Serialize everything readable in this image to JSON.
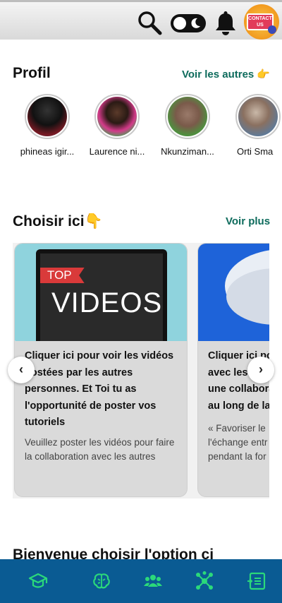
{
  "header": {
    "contact_badge": "CONTACT US",
    "icons": [
      "search-icon",
      "dark-mode-toggle",
      "bell-icon",
      "contact-us-button"
    ]
  },
  "profiles_section": {
    "title": "Profil",
    "see_all": "Voir les autres 👉",
    "profiles": [
      {
        "name": "phineas igir..."
      },
      {
        "name": "Laurence ni..."
      },
      {
        "name": "Nkunziman..."
      },
      {
        "name": "Orti Sma"
      }
    ]
  },
  "choose_section": {
    "title": "Choisir ici👇",
    "see_more": "Voir plus",
    "cards": [
      {
        "badge": "TOP",
        "media_text": "VIDEOS",
        "title": "Cliquer ici pour voir les vidéos postées par les autres personnes. Et Toi tu as l'opportunité de poster vos tutoriels",
        "description": "Veuillez poster les vidéos pour faire la collaboration avec les autres"
      },
      {
        "title": "Cliquer ici po avec les aut une collabora au long de la",
        "description": "« Favoriser le l'échange entr pendant la for"
      }
    ],
    "prev_label": "‹",
    "next_label": "›"
  },
  "next_section": {
    "title": "Bienvenue choisir l'option ci"
  },
  "bottom_nav": {
    "items": [
      "graduation-cap-icon",
      "brain-icon",
      "users-icon",
      "network-icon",
      "exit-icon"
    ],
    "accent": "#2bd97a",
    "background": "#0a5b93"
  }
}
